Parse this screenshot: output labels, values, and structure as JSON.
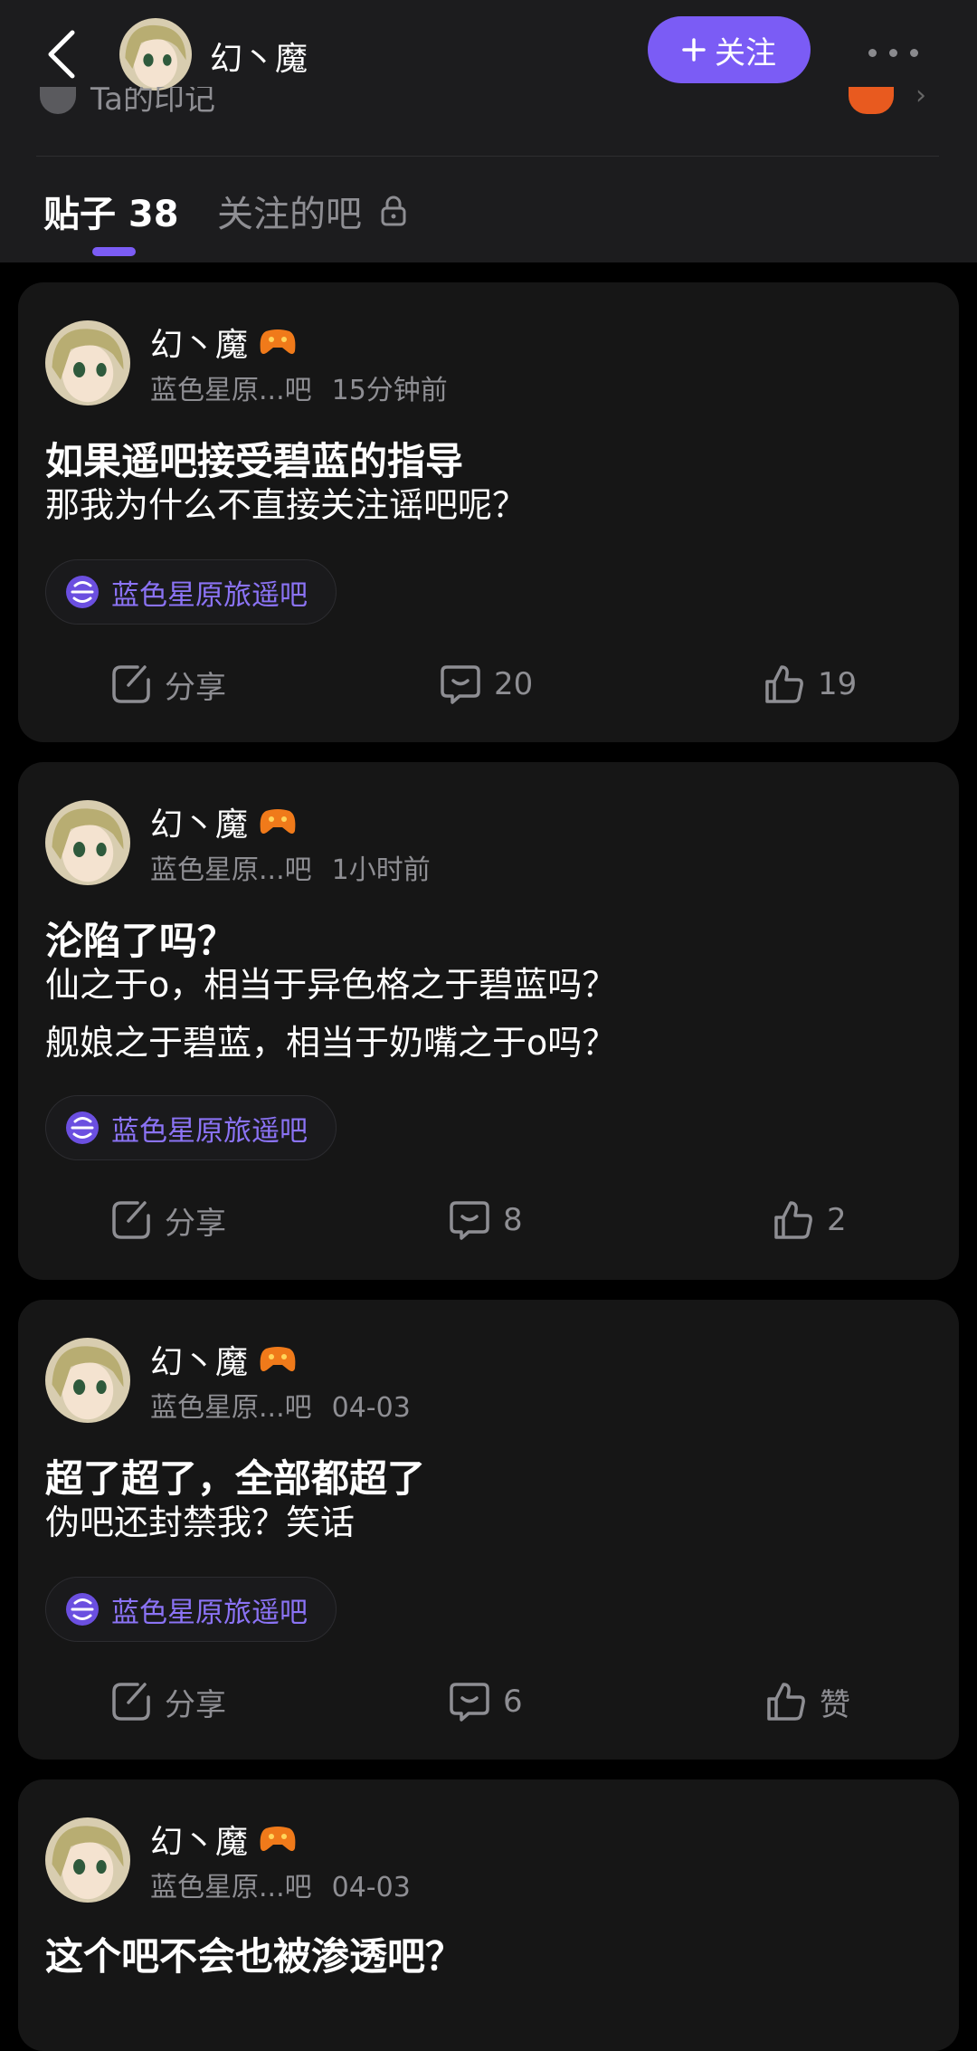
{
  "header": {
    "user_name": "幻丶魔",
    "follow_label": "关注",
    "impression_label": "Ta的印记"
  },
  "tabs": [
    {
      "label": "贴子 38",
      "active": true
    },
    {
      "label": "关注的吧",
      "active": false,
      "locked": true
    }
  ],
  "colors": {
    "accent": "#7b5cf5",
    "tag_text": "#8b73f5",
    "card_bg": "#161616",
    "header_bg": "#1c1c1e"
  },
  "posts": [
    {
      "author": "幻丶魔",
      "forum_short": "蓝色星原...吧",
      "time": "15分钟前",
      "title": "如果遥吧接受碧蓝的指导",
      "body": [
        "那我为什么不直接关注谣吧呢？"
      ],
      "tag": "蓝色星原旅遥吧",
      "share_label": "分享",
      "comments": "20",
      "likes": "19"
    },
    {
      "author": "幻丶魔",
      "forum_short": "蓝色星原...吧",
      "time": "1小时前",
      "title": "沦陷了吗？",
      "body": [
        "仙之于o，相当于异色格之于碧蓝吗？",
        "舰娘之于碧蓝，相当于奶嘴之于o吗？"
      ],
      "tag": "蓝色星原旅遥吧",
      "share_label": "分享",
      "comments": "8",
      "likes": "2"
    },
    {
      "author": "幻丶魔",
      "forum_short": "蓝色星原...吧",
      "time": "04-03",
      "title": "超了超了，全部都超了",
      "body": [
        "伪吧还封禁我？笑话"
      ],
      "tag": "蓝色星原旅遥吧",
      "share_label": "分享",
      "comments": "6",
      "likes": "赞"
    },
    {
      "author": "幻丶魔",
      "forum_short": "蓝色星原...吧",
      "time": "04-03",
      "title": "这个吧不会也被渗透吧？"
    }
  ]
}
